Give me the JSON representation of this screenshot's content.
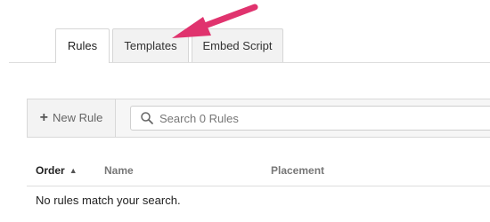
{
  "tabs": [
    {
      "label": "Rules",
      "active": true
    },
    {
      "label": "Templates",
      "active": false
    },
    {
      "label": "Embed Script",
      "active": false
    }
  ],
  "toolbar": {
    "new_rule_label": "New Rule",
    "search_placeholder": "Search 0 Rules"
  },
  "table": {
    "columns": [
      "Order",
      "Name",
      "Placement"
    ],
    "sort_column": "Order",
    "sort_direction": "ascending",
    "empty_message": "No rules match your search."
  },
  "annotation": {
    "icon": "arrow-icon",
    "color": "#e0336e"
  }
}
